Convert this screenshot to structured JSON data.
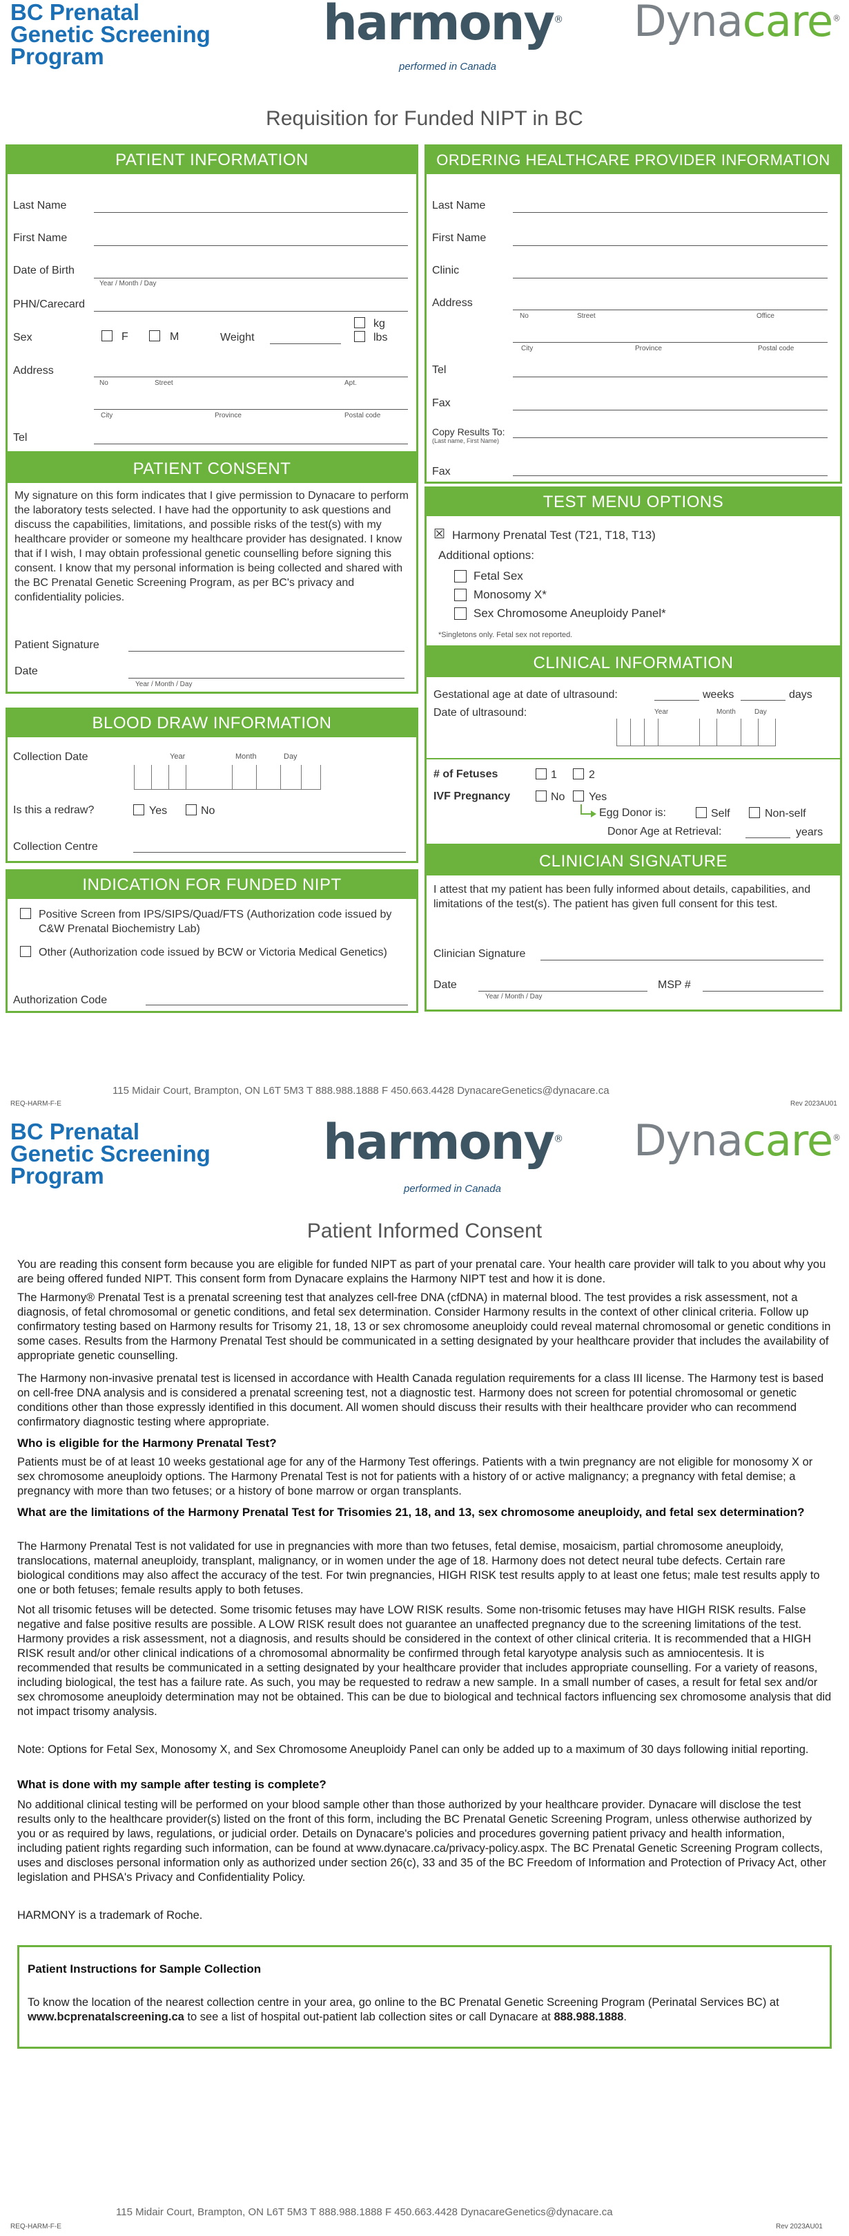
{
  "page1": {
    "logo_bc": [
      "BC Prenatal",
      "Genetic Screening",
      "Program"
    ],
    "logo_harmony": "harmony",
    "logo_harmony_reg": "®",
    "logo_performed": "performed in Canada",
    "logo_dyna_a": "Dyna",
    "logo_dyna_b": "care",
    "title": "Requisition for Funded NIPT in BC",
    "patient_info": {
      "header": "PATIENT INFORMATION",
      "last_name": "Last Name",
      "first_name": "First Name",
      "dob": "Date of Birth",
      "dob_hint": "Year / Month / Day",
      "phn": "PHN/Carecard",
      "sex": "Sex",
      "sex_f": "F",
      "sex_m": "M",
      "weight": "Weight",
      "kg": "kg",
      "lbs": "lbs",
      "address": "Address",
      "addr_no": "No",
      "addr_street": "Street",
      "addr_apt": "Apt.",
      "addr_city": "City",
      "addr_province": "Province",
      "addr_postal": "Postal code",
      "tel": "Tel"
    },
    "provider_info": {
      "header": "ORDERING HEALTHCARE PROVIDER INFORMATION",
      "last_name": "Last Name",
      "first_name": "First Name",
      "clinic": "Clinic",
      "address": "Address",
      "addr_no": "No",
      "addr_street": "Street",
      "addr_office": "Office",
      "addr_city": "City",
      "addr_province": "Province",
      "addr_postal": "Postal code",
      "tel": "Tel",
      "fax": "Fax",
      "copy_to": "Copy Results To:",
      "copy_to_hint": "(Last name, First Name)",
      "fax2": "Fax"
    },
    "patient_consent": {
      "header": "PATIENT CONSENT",
      "text": "My signature on this form indicates that I give permission to Dynacare to perform the laboratory tests selected. I have had the opportunity to ask questions and discuss the capabilities, limitations, and possible risks of the test(s) with my healthcare provider or someone my healthcare provider has designated. I know that if I wish, I may obtain professional genetic counselling before signing this consent. I know that my personal information is being collected and shared with the BC Prenatal Genetic Screening Program, as per BC's privacy and confidentiality policies.",
      "signature": "Patient Signature",
      "date": "Date",
      "date_hint": "Year / Month / Day"
    },
    "test_menu": {
      "header": "TEST MENU OPTIONS",
      "checked_mark": "☒",
      "harmony": "Harmony Prenatal Test (T21, T18, T13)",
      "additional": "Additional options:",
      "opt1": "Fetal Sex",
      "opt2": "Monosomy X*",
      "opt3": "Sex Chromosome Aneuploidy Panel*",
      "note": "*Singletons only. Fetal sex not reported."
    },
    "clinical": {
      "header": "CLINICAL INFORMATION",
      "ga": "Gestational age at date of ultrasound:",
      "weeks": "weeks",
      "days": "days",
      "date_us": "Date of ultrasound:",
      "year": "Year",
      "month": "Month",
      "day": "Day",
      "fetuses": "# of Fetuses",
      "f1": "1",
      "f2": "2",
      "ivf": "IVF Pregnancy",
      "no": "No",
      "yes": "Yes",
      "egg_donor": "Egg Donor is:",
      "self": "Self",
      "non_self": "Non-self",
      "donor_age": "Donor Age at Retrieval:",
      "years": "years"
    },
    "blood_draw": {
      "header": "BLOOD DRAW INFORMATION",
      "collection_date": "Collection Date",
      "year": "Year",
      "month": "Month",
      "day": "Day",
      "redraw": "Is this a redraw?",
      "yes": "Yes",
      "no": "No",
      "centre": "Collection Centre"
    },
    "clinician_sig": {
      "header": "CLINICIAN SIGNATURE",
      "text": "I attest that my patient has been fully informed about details, capabilities, and limitations of the test(s). The patient has given full consent for this test.",
      "signature": "Clinician Signature",
      "date": "Date",
      "date_hint": "Year / Month / Day",
      "msp": "MSP #"
    },
    "indication": {
      "header": "INDICATION FOR FUNDED NIPT",
      "opt1": "Positive Screen from IPS/SIPS/Quad/FTS (Authorization code issued by C&W Prenatal Biochemistry Lab)",
      "opt2": "Other (Authorization code issued by BCW or Victoria Medical Genetics)",
      "auth_code": "Authorization Code"
    },
    "footer": "115 Midair Court, Brampton, ON L6T 5M3   T 888.988.1888   F 450.663.4428   DynacareGenetics@dynacare.ca",
    "ref_left": "REQ-HARM-F-E",
    "ref_right": "Rev 2023AU01"
  },
  "page2": {
    "title": "Patient Informed Consent",
    "p1": "You are reading this consent form because you are eligible for funded NIPT as part of your prenatal care. Your health care provider will talk to you about why you are being offered funded NIPT. This consent form from Dynacare explains the Harmony NIPT test and how it is done.",
    "p2": "The Harmony® Prenatal Test is a prenatal screening test that analyzes cell-free DNA (cfDNA) in maternal blood. The test provides a risk assessment, not a diagnosis, of fetal chromosomal or genetic conditions, and fetal sex determination. Consider Harmony results in the context of other clinical criteria. Follow up confirmatory testing based on Harmony results for Trisomy 21, 18, 13 or sex chromosome aneuploidy could reveal maternal chromosomal or genetic conditions in some cases. Results from the Harmony Prenatal Test should be communicated in a setting designated by your healthcare provider that includes the availability of appropriate genetic counselling.",
    "p3": "The Harmony non-invasive prenatal test is licensed in accordance with Health Canada regulation requirements for a class III license. The Harmony test is based on cell-free DNA analysis and is considered a prenatal screening test, not a diagnostic test. Harmony does not screen for potential chromosomal or genetic conditions other than those expressly identified in this document. All women should discuss their results with their healthcare provider who can recommend confirmatory diagnostic testing where appropriate.",
    "h1": "Who is eligible for the Harmony Prenatal Test?",
    "p4": "Patients must be of at least 10 weeks gestational age for any of the Harmony Test offerings. Patients with a twin pregnancy are not eligible for monosomy X or sex chromosome aneuploidy options. The Harmony Prenatal Test is not for patients with a history of or active malignancy; a pregnancy with fetal demise; a pregnancy with more than two fetuses; or a history of bone marrow or organ transplants.",
    "h2": "What are the limitations of the Harmony Prenatal Test for Trisomies 21, 18, and 13, sex chromosome aneuploidy, and fetal sex determination?",
    "p5": "The Harmony Prenatal Test is not validated for use in pregnancies with more than two fetuses, fetal demise, mosaicism, partial chromosome aneuploidy, translocations, maternal aneuploidy, transplant, malignancy, or in women under the age of 18. Harmony does not detect neural tube defects. Certain rare biological conditions may also affect the accuracy of the test. For twin pregnancies, HIGH RISK test results apply to at least one fetus; male test results apply to one or both fetuses; female results apply to both fetuses.",
    "p6": "Not all trisomic fetuses will be detected. Some trisomic fetuses may have LOW RISK results. Some non-trisomic fetuses may have HIGH RISK results. False negative and false positive results are possible. A LOW RISK result does not guarantee an unaffected pregnancy due to the screening limitations of the test. Harmony provides a risk assessment, not a diagnosis, and results should be considered in the context of other clinical criteria. It is recommended that a HIGH RISK result and/or other clinical indications of a chromosomal abnormality be confirmed through fetal karyotype analysis such as amniocentesis. It is recommended that results be communicated in a setting designated by your healthcare provider that includes appropriate counselling. For a variety of reasons, including biological, the test has a failure rate. As such, you may be requested to redraw a new sample. In a small number of cases, a result for fetal sex and/or sex chromosome aneuploidy determination may not be obtained. This can be due to biological and technical factors influencing sex chromosome analysis that did not impact trisomy analysis.",
    "p7": "Note: Options for Fetal Sex, Monosomy X, and Sex Chromosome Aneuploidy Panel can only be added up to a maximum of 30 days following initial reporting.",
    "h3": "What is done with my sample after testing is complete?",
    "p8": "No additional clinical testing will be performed on your blood sample other than those authorized by your healthcare provider. Dynacare will disclose the test results only to the healthcare provider(s) listed on the front of this form, including the BC Prenatal Genetic Screening Program, unless otherwise authorized by you or as required by laws, regulations, or judicial order. Details on Dynacare's policies and procedures governing patient privacy and health information, including patient rights regarding such information, can be found at www.dynacare.ca/privacy-policy.aspx. The BC Prenatal Genetic Screening Program collects, uses and discloses personal information only as authorized under section 26(c), 33 and 35 of the BC Freedom of Information and Protection of Privacy Act, other legislation and PHSA's Privacy and Confidentiality Policy.",
    "p9": "HARMONY is a trademark of Roche.",
    "instr_title": "Patient Instructions for Sample Collection",
    "instr_a": "To know the location of the nearest collection centre in your area, go online to the BC Prenatal Genetic Screening Program (Perinatal Services BC) at ",
    "instr_url": "www.bcprenatalscreening.ca",
    "instr_b": " to see a list of hospital out-patient lab collection sites or call Dynacare at ",
    "instr_phone": "888.988.1888",
    "instr_c": ".",
    "footer": "115 Midair Court, Brampton, ON L6T 5M3   T 888.988.1888   F 450.663.4428   DynacareGenetics@dynacare.ca",
    "ref_left": "REQ-HARM-F-E",
    "ref_right": "Rev 2023AU01"
  }
}
